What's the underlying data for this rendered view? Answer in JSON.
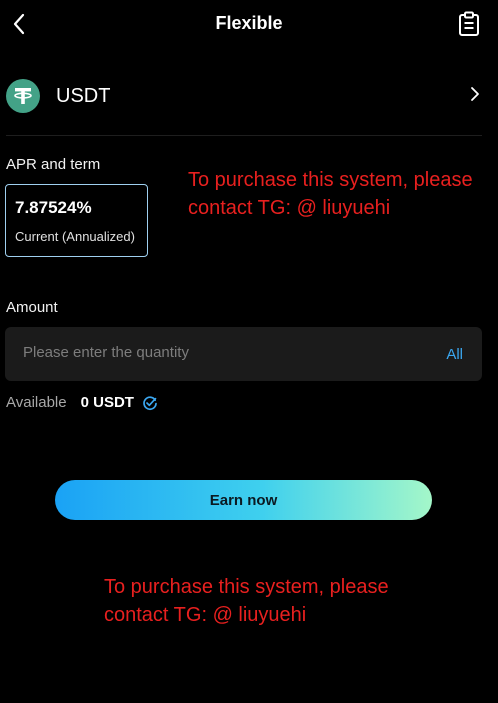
{
  "header": {
    "title": "Flexible",
    "back_icon": "chevron-left-icon",
    "record_icon": "clipboard-list-icon"
  },
  "coin": {
    "name": "USDT",
    "logo_icon": "tether-logo-icon",
    "logo_color": "#43a287"
  },
  "apr": {
    "label": "APR and term",
    "value": "7.87524%",
    "caption": "Current (Annualized)"
  },
  "amount": {
    "label": "Amount",
    "placeholder": "Please enter the quantity",
    "all_label": "All"
  },
  "available": {
    "label": "Available",
    "value": "0 USDT",
    "icon": "refresh-check-icon"
  },
  "earn_button": {
    "label": "Earn now",
    "gradient": [
      "#1aa2f5",
      "#3fd0ee",
      "#a4f7c9"
    ]
  },
  "watermarks": [
    "To purchase this system, please contact TG: @ liuyuehi",
    "To purchase this system, please contact TG: @ liuyuehi"
  ],
  "colors": {
    "accent": "#3ba7f0",
    "watermark": "#e8201f",
    "background": "#000000"
  }
}
